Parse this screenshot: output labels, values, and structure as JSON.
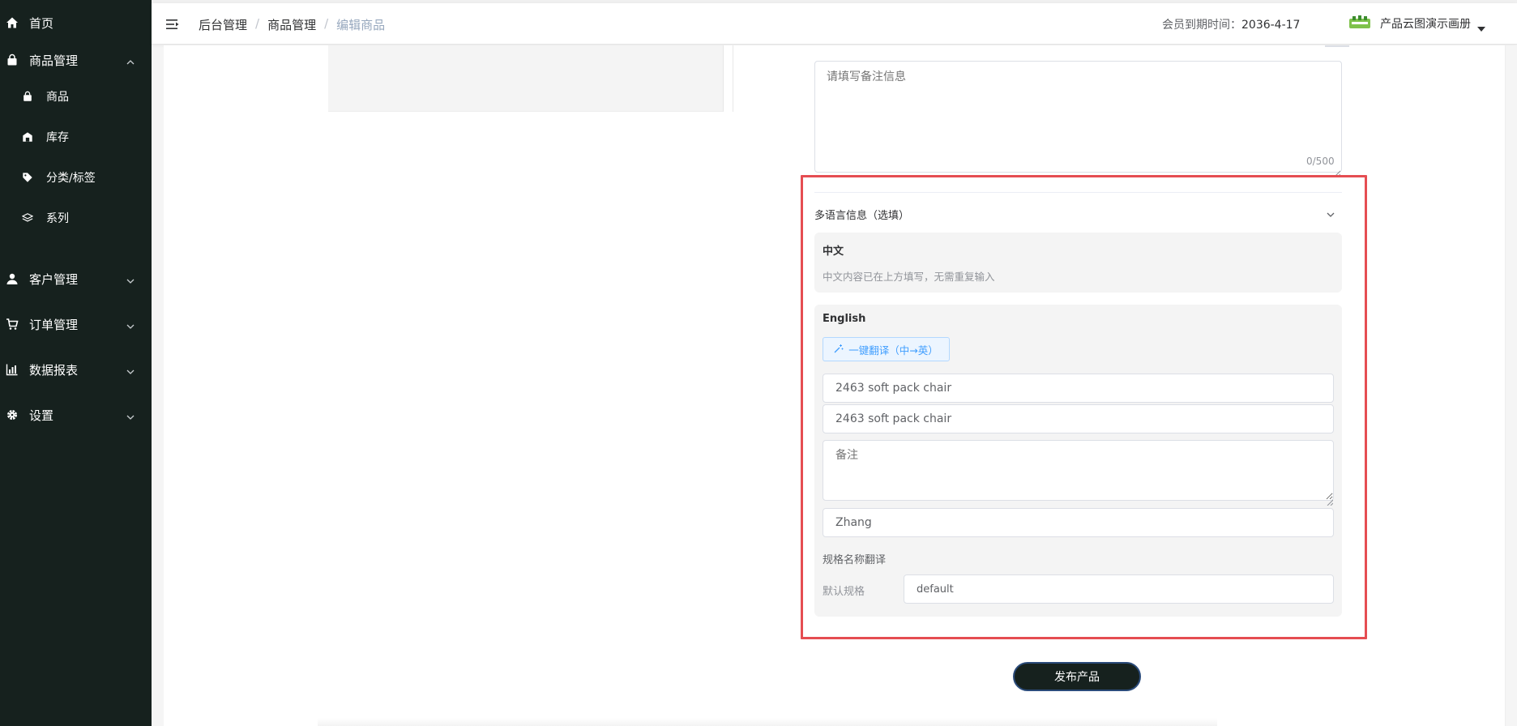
{
  "sidebar": {
    "items": [
      {
        "label": "首页",
        "icon": "home-icon"
      },
      {
        "label": "商品管理",
        "icon": "bag-icon",
        "expanded": true,
        "children": [
          {
            "label": "商品",
            "icon": "bag-icon"
          },
          {
            "label": "库存",
            "icon": "warehouse-icon"
          },
          {
            "label": "分类/标签",
            "icon": "tag-icon"
          },
          {
            "label": "系列",
            "icon": "layers-icon"
          }
        ]
      },
      {
        "label": "客户管理",
        "icon": "user-icon"
      },
      {
        "label": "订单管理",
        "icon": "cart-icon"
      },
      {
        "label": "数据报表",
        "icon": "chart-icon"
      },
      {
        "label": "设置",
        "icon": "gear-icon"
      }
    ]
  },
  "header": {
    "breadcrumb": [
      "后台管理",
      "商品管理",
      "编辑商品"
    ],
    "member_label": "会员到期时间：",
    "member_date": "2036-4-17",
    "user_name": "产品云图演示画册"
  },
  "form": {
    "remark_placeholder": "请填写备注信息",
    "remark_count": "0/500",
    "multilang_title": "多语言信息（选填）",
    "zh": {
      "title": "中文",
      "hint": "中文内容已在上方填写，无需重复输入"
    },
    "en": {
      "title": "English",
      "translate_button": "一键翻译（中→英）",
      "name_value": "2463 soft pack chair",
      "name2_value": "2463 soft pack chair",
      "remark_placeholder": "备注",
      "brand_value": "Zhang",
      "spec_title": "规格名称翻译",
      "spec_name": "默认规格",
      "spec_value": "default"
    },
    "publish_button": "发布产品"
  },
  "colors": {
    "sidebar_bg": "#16211e",
    "highlight": "#e54d52",
    "link": "#409eff",
    "breadcrumb_current": "#97a8be"
  }
}
